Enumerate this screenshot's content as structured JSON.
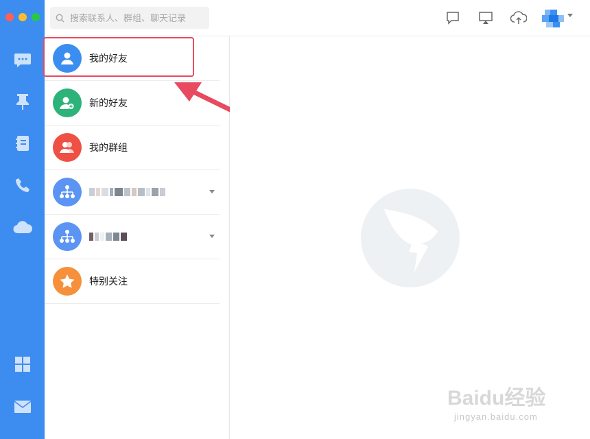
{
  "window": {
    "controls": [
      "close",
      "minimize",
      "maximize"
    ]
  },
  "sidebar": {
    "items": [
      {
        "icon": "chat-bubble-icon"
      },
      {
        "icon": "pin-icon"
      },
      {
        "icon": "contacts-book-icon"
      },
      {
        "icon": "phone-icon"
      },
      {
        "icon": "cloud-icon"
      },
      {
        "icon": "apps-grid-icon"
      },
      {
        "icon": "mail-icon"
      }
    ],
    "color": "#3d8df0"
  },
  "search": {
    "placeholder": "搜索联系人、群组、聊天记录"
  },
  "toolbar": {
    "icons": [
      "message-icon",
      "screen-share-icon",
      "cloud-upload-icon"
    ]
  },
  "contacts": {
    "items": [
      {
        "label": "我的好友",
        "color": "#3b8ef0"
      },
      {
        "label": "新的好友",
        "color": "#2db37a"
      },
      {
        "label": "我的群组",
        "color": "#ee5144"
      },
      {
        "label": "",
        "color": "#5b94f3"
      },
      {
        "label": "",
        "color": "#5b94f3"
      },
      {
        "label": "特别关注",
        "color": "#f7903b"
      }
    ]
  },
  "watermark": {
    "text": "jingyan.baidu.com",
    "brand": "Baidu经验"
  }
}
